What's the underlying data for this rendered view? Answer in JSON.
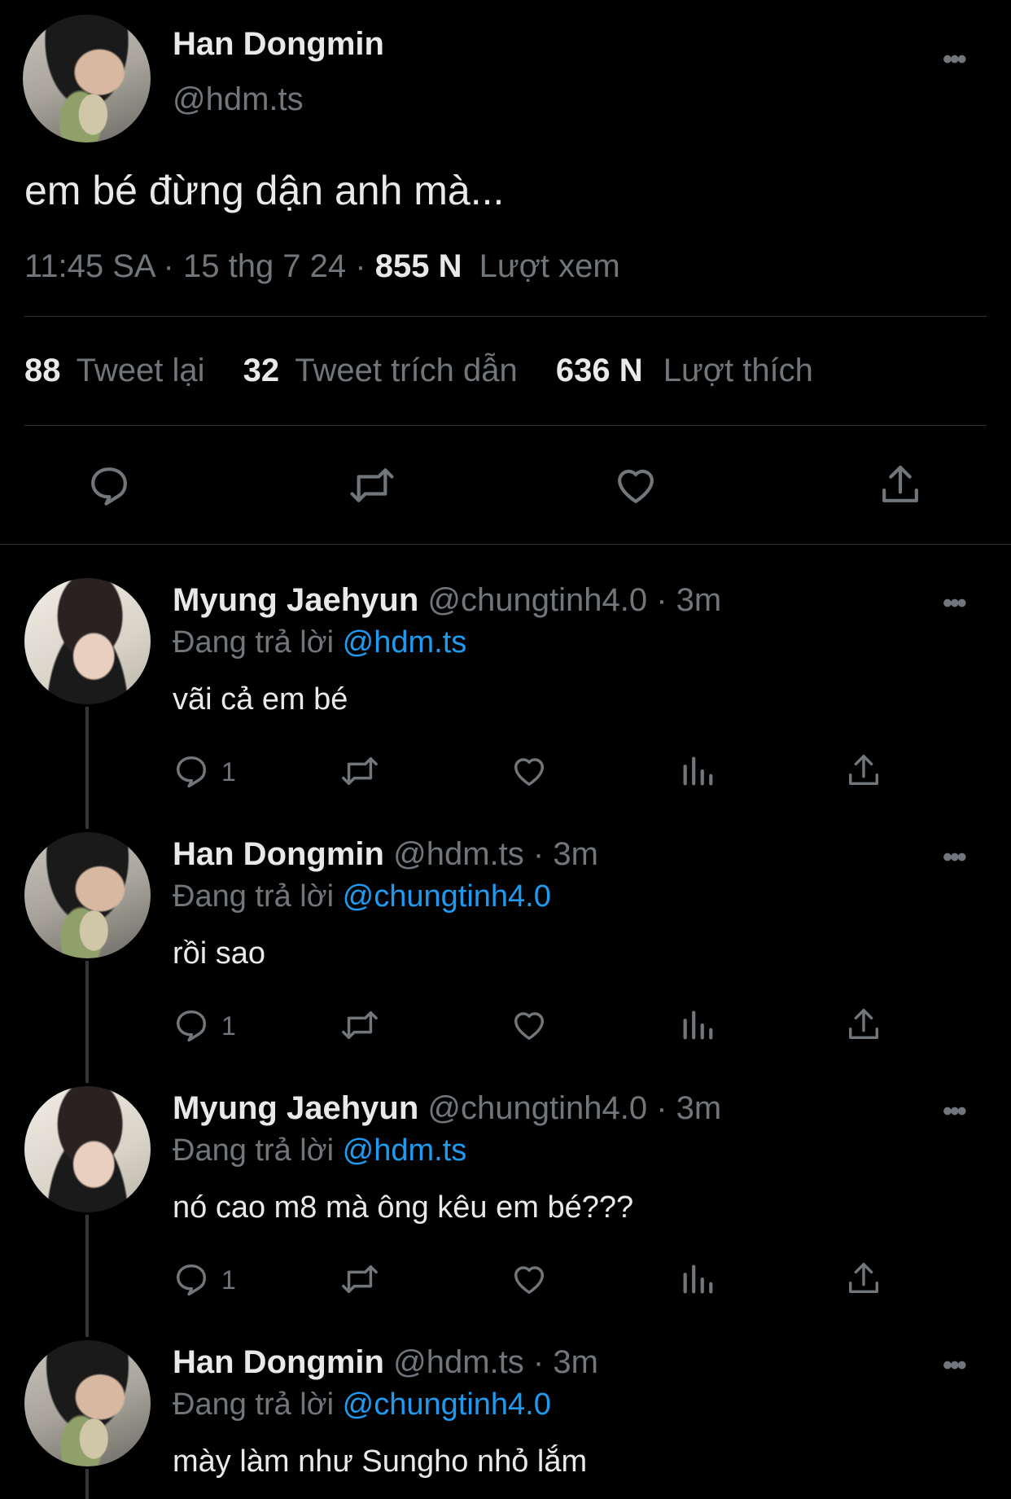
{
  "main_tweet": {
    "author_name": "Han Dongmin",
    "author_handle": "@hdm.ts",
    "text": "em bé đừng dận anh mà...",
    "time": "11:45 SA",
    "sep1": "·",
    "date": "15 thg 7 24",
    "sep2": "·",
    "views_count": "855 N",
    "views_label": "Lượt xem",
    "retweets_count": "88",
    "retweets_label": "Tweet lại",
    "quotes_count": "32",
    "quotes_label": "Tweet trích dẫn",
    "likes_count": "636 N",
    "likes_label": "Lượt thích",
    "actions": [
      "reply-icon",
      "retweet-icon",
      "like-icon",
      "share-icon"
    ]
  },
  "replies": [
    {
      "name": "Myung Jaehyun",
      "handle": "@chungtinh4.0",
      "time": "· 3m",
      "replying_label": "Đang trả lời",
      "replying_to": "@hdm.ts",
      "text": "vãi cả em bé",
      "reply_count": "1"
    },
    {
      "name": "Han Dongmin",
      "handle": "@hdm.ts",
      "time": "· 3m",
      "replying_label": "Đang trả lời",
      "replying_to": "@chungtinh4.0",
      "text": "rồi sao",
      "reply_count": "1"
    },
    {
      "name": "Myung Jaehyun",
      "handle": "@chungtinh4.0",
      "time": "· 3m",
      "replying_label": "Đang trả lời",
      "replying_to": "@hdm.ts",
      "text": "nó cao m8 mà ông kêu em bé???",
      "reply_count": "1"
    },
    {
      "name": "Han Dongmin",
      "handle": "@hdm.ts",
      "time": "· 3m",
      "replying_label": "Đang trả lời",
      "replying_to": "@chungtinh4.0",
      "text": "mày làm như Sungho nhỏ lắm"
    }
  ],
  "more_icon": "•••",
  "colors": {
    "background": "#000000",
    "text": "#e7e9ea",
    "muted": "#71767b",
    "link": "#1d9bf0"
  }
}
